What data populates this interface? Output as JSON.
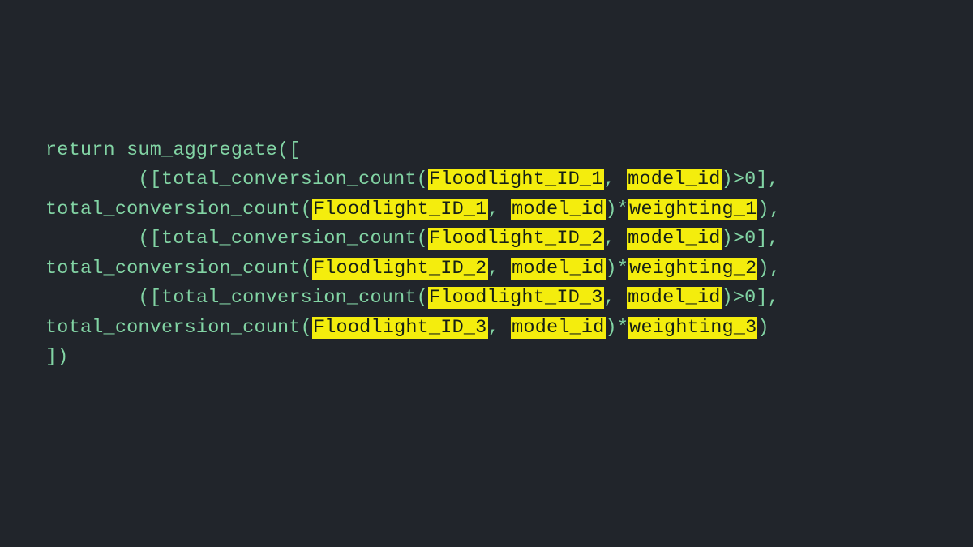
{
  "code": {
    "line1": "return sum_aggregate([",
    "indent1": "        ",
    "fn_open": "[total_conversion_count(",
    "fn2_open": "total_conversion_count(",
    "comma_sp": ", ",
    "cond_close": ")>0],",
    "mult": ")*",
    "row_end_comma": "),",
    "row_end": ")",
    "fl1": "Floodlight_ID_1",
    "fl2": "Floodlight_ID_2",
    "fl3": "Floodlight_ID_3",
    "mid": "model_id",
    "w1": "weighting_1",
    "w2": "weighting_2",
    "w3": "weighting_3",
    "close": "])"
  }
}
